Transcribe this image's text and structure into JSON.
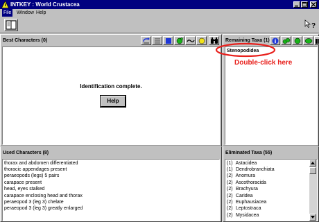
{
  "window": {
    "title": "INTKEY : World Crustacea"
  },
  "menu": {
    "items": [
      "File",
      "Window",
      "Help"
    ]
  },
  "best_characters": {
    "title": "Best Characters (0)",
    "message": "Identification complete.",
    "help_button": "Help"
  },
  "remaining_taxa": {
    "title": "Remaining Taxa (1)",
    "items": [
      "Stenopodidea"
    ]
  },
  "annotation": {
    "text": "Double-click here",
    "color": "#e8201c"
  },
  "used_characters": {
    "title": "Used Characters (8)",
    "items": [
      "thorax and abdomen differentiated",
      "thoracic appendages present",
      "peraeopods (legs) 5 pairs",
      "carapace present",
      "head, eyes stalked",
      "carapace enclosing head and thorax",
      "peraeopod 3 (leg 3) chelate",
      "peraeopod 3 (leg 3) greatly enlarged"
    ]
  },
  "eliminated_taxa": {
    "title": "Eliminated Taxa (55)",
    "items": [
      {
        "count": "(1)",
        "name": "Astacidea"
      },
      {
        "count": "(1)",
        "name": "Dendrobranchiata"
      },
      {
        "count": "(2)",
        "name": "Anomura"
      },
      {
        "count": "(2)",
        "name": "Ascothoracida"
      },
      {
        "count": "(2)",
        "name": "Brachyura"
      },
      {
        "count": "(2)",
        "name": "Caridea"
      },
      {
        "count": "(2)",
        "name": "Euphausiacea"
      },
      {
        "count": "(2)",
        "name": "Leptostraca"
      },
      {
        "count": "(2)",
        "name": "Mysidacea"
      }
    ]
  },
  "colors": {
    "titlebar": "#000080",
    "accent_blue": "#1f37d8",
    "icon_green": "#19b319",
    "icon_yellow": "#f2e21a"
  }
}
